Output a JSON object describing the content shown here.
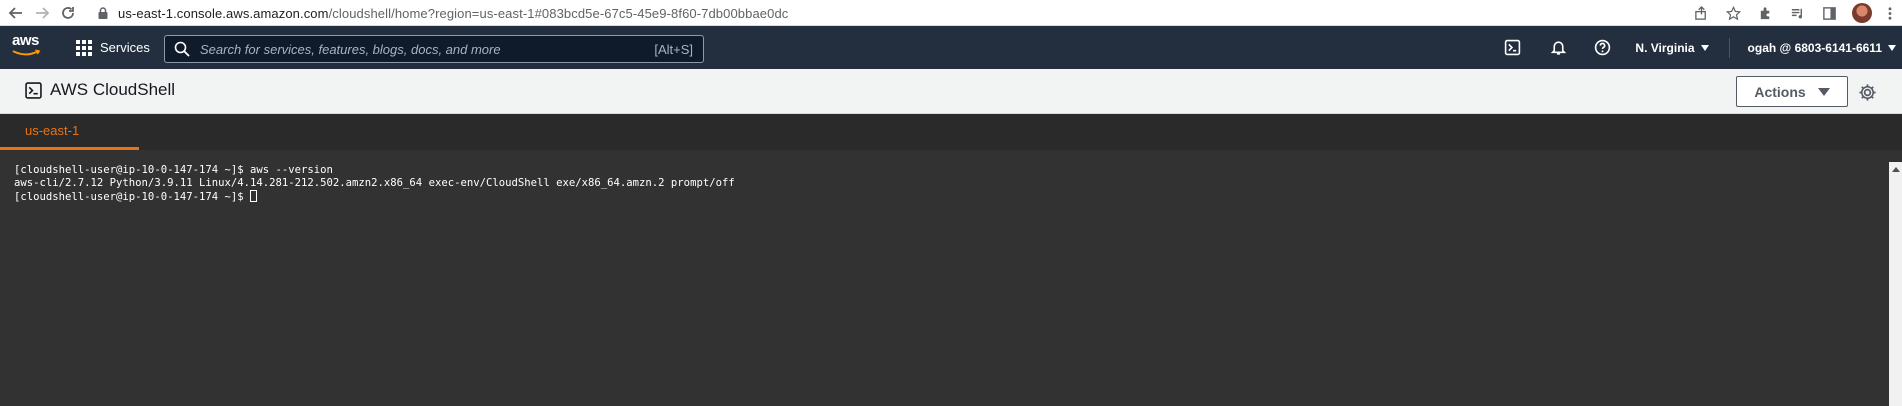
{
  "browser": {
    "url_host": "us-east-1.console.aws.amazon.com",
    "url_path": "/cloudshell/home?region=us-east-1#083bcd5e-67c5-45e9-8f60-7db00bbae0dc"
  },
  "aws_nav": {
    "logo": "aws",
    "services_label": "Services",
    "search_placeholder": "Search for services, features, blogs, docs, and more",
    "search_shortcut": "[Alt+S]",
    "region": "N. Virginia",
    "account": "ogah @ 6803-6141-6611"
  },
  "cloudshell": {
    "title": "AWS CloudShell",
    "actions_label": "Actions",
    "tab_label": "us-east-1"
  },
  "terminal": {
    "lines": [
      "[cloudshell-user@ip-10-0-147-174 ~]$ aws --version",
      "aws-cli/2.7.12 Python/3.9.11 Linux/4.14.281-212.502.amzn2.x86_64 exec-env/CloudShell exe/x86_64.amzn.2 prompt/off",
      "[cloudshell-user@ip-10-0-147-174 ~]$ "
    ]
  },
  "colors": {
    "aws_nav_bg": "#232f3e",
    "accent_orange": "#ec7211",
    "terminal_bg": "#323232"
  }
}
